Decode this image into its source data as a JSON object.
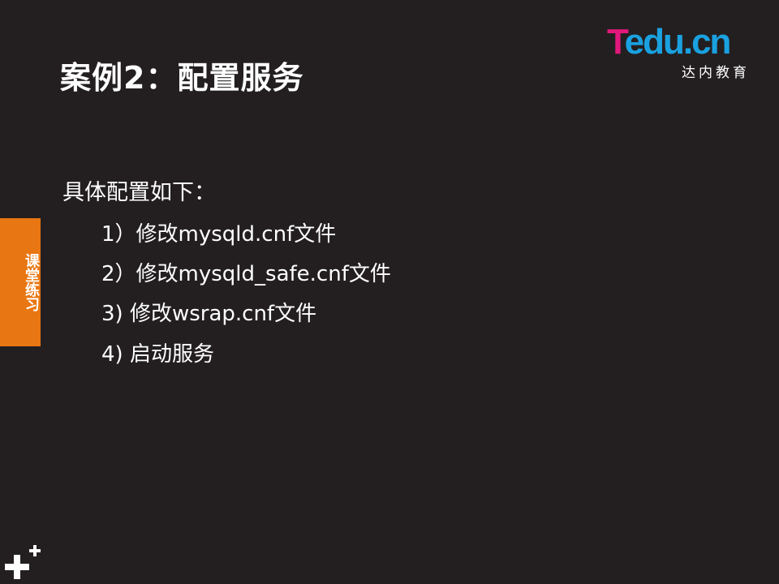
{
  "slide": {
    "title": "案例2：配置服务",
    "logo": {
      "letter_t": "T",
      "rest": "edu.cn",
      "subtitle": "达内教育",
      "colors": {
        "pink": "#e2187d",
        "blue": "#1aa1e0"
      }
    },
    "side_tab": {
      "label": "课堂练习",
      "color": "#e87612"
    },
    "intro": "具体配置如下：",
    "steps": [
      "1）修改mysqld.cnf文件",
      "2）修改mysqld_safe.cnf文件",
      "3)   修改wsrap.cnf文件",
      "4)   启动服务"
    ],
    "background_color": "#231f20"
  }
}
